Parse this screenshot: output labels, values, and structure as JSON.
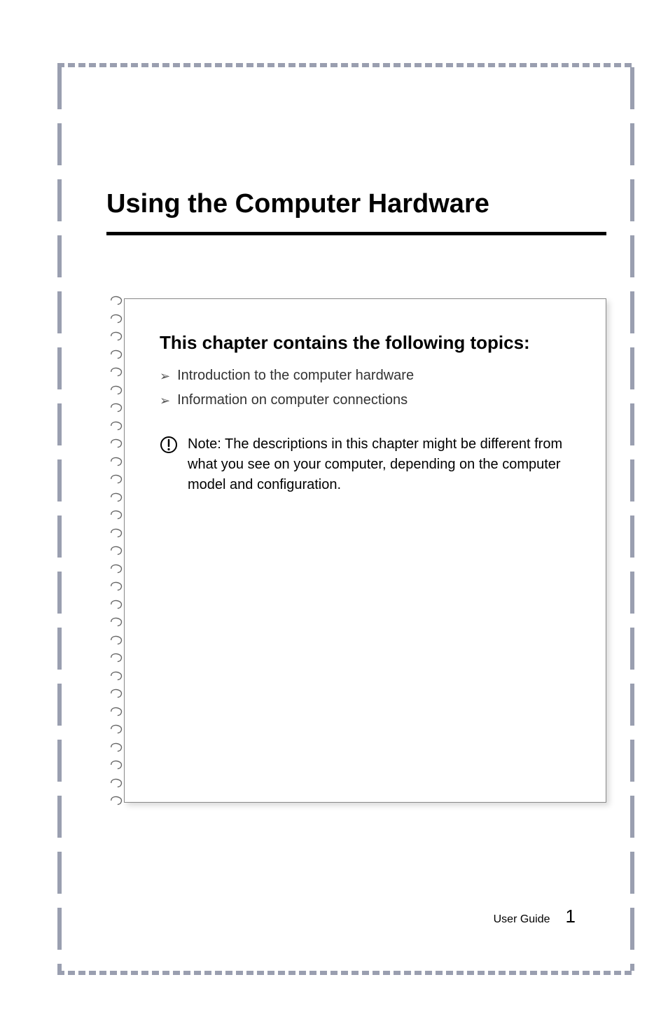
{
  "chapter": {
    "title": "Using the Computer Hardware"
  },
  "section": {
    "heading": "This chapter contains the following topics:",
    "bullets": [
      "Introduction to the computer hardware",
      "Information on computer connections"
    ]
  },
  "note": {
    "label": "Note:",
    "body": " The descriptions in this chapter might be different from what you see on your computer, depending on the computer model and configuration."
  },
  "footer": {
    "label": "User Guide",
    "page_number": "1"
  }
}
